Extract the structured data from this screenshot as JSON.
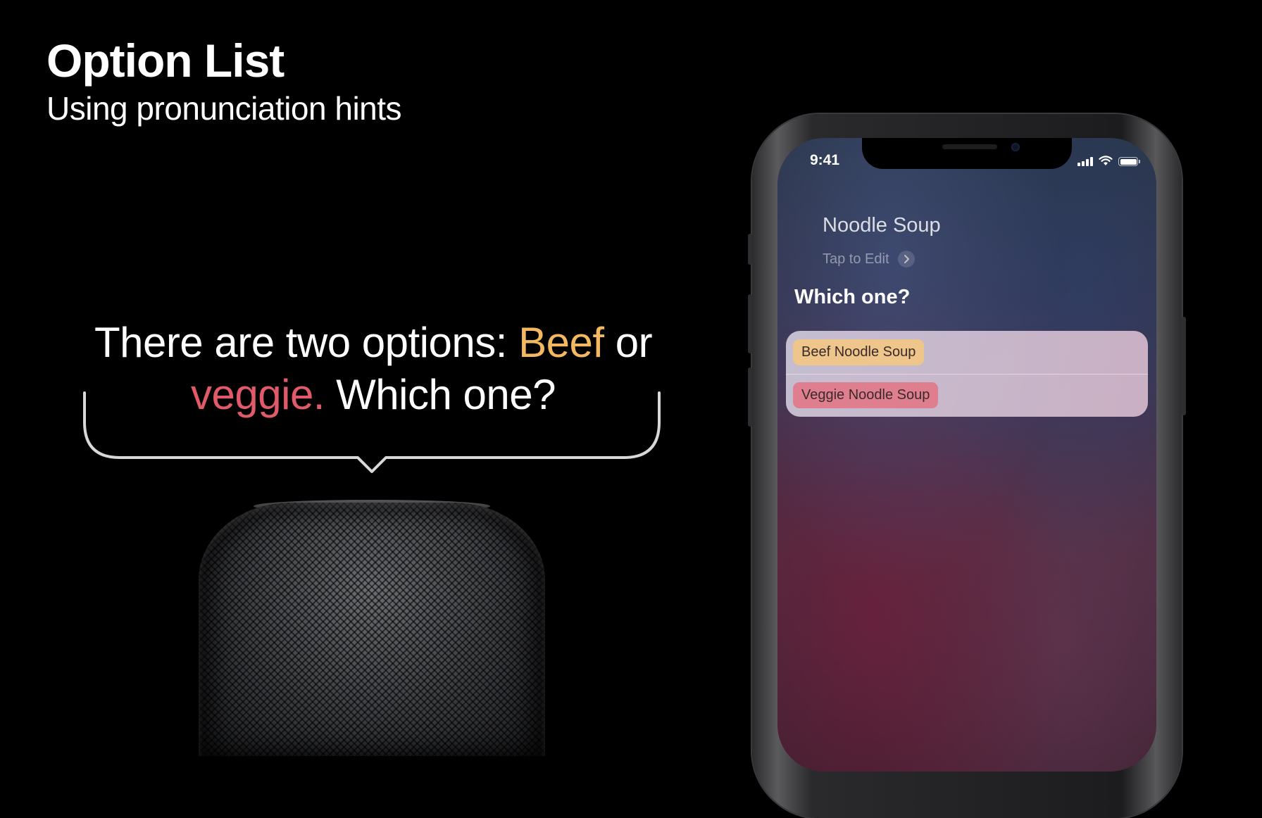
{
  "slide": {
    "title": "Option List",
    "subtitle": "Using pronunciation hints"
  },
  "speech": {
    "part1": "There are two options: ",
    "beef": "Beef",
    "part2": " or",
    "veggie": "veggie.",
    "part3": " Which one?",
    "colors": {
      "beef": "#f4b860",
      "veggie": "#e05a6a"
    }
  },
  "phone": {
    "status": {
      "time": "9:41",
      "icons": [
        "cellular-signal-icon",
        "wifi-icon",
        "battery-icon"
      ]
    },
    "siri": {
      "query": "Noodle Soup",
      "tap_to_edit": "Tap to Edit",
      "prompt": "Which one?",
      "options": [
        {
          "label": "Beef Noodle Soup",
          "color": "#eec58b"
        },
        {
          "label": "Veggie Noodle Soup",
          "color": "#de7e8e"
        }
      ]
    }
  }
}
